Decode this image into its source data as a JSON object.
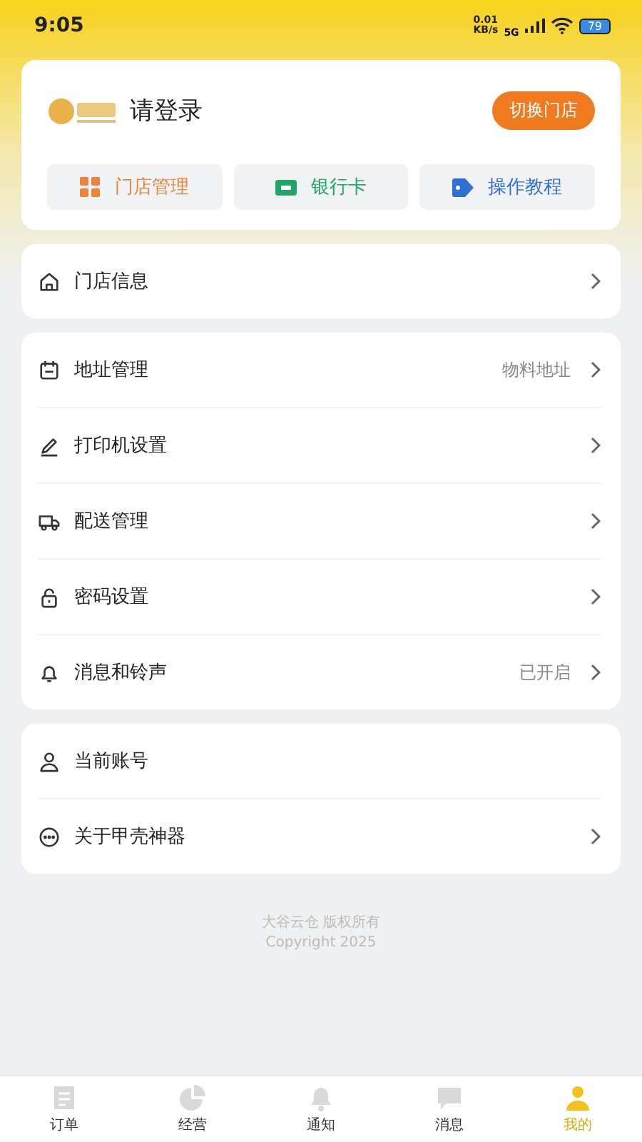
{
  "status_bar": {
    "time": "9:05",
    "speed": "0.01",
    "speed_unit": "KB/s",
    "network": "5G",
    "battery": "79"
  },
  "header": {
    "store_name": "请登录",
    "switch_button": "切换门店",
    "shortcuts": [
      {
        "kind": "grid",
        "label": "门店管理",
        "color": "#e8853a"
      },
      {
        "kind": "card",
        "label": "银行卡",
        "color": "#22a567"
      },
      {
        "kind": "tag",
        "label": "操作教程",
        "color": "#2f6fd8"
      }
    ]
  },
  "groups": [
    [
      {
        "kind": "home",
        "label": "门店信息"
      }
    ],
    [
      {
        "kind": "calendar",
        "label": "地址管理",
        "value": "物料地址"
      },
      {
        "kind": "pen",
        "label": "打印机设置"
      },
      {
        "kind": "truck",
        "label": "配送管理"
      },
      {
        "kind": "lock",
        "label": "密码设置"
      },
      {
        "kind": "bell",
        "label": "消息和铃声",
        "value": "已开启"
      }
    ],
    [
      {
        "kind": "person",
        "label": "当前账号",
        "arrow": false
      },
      {
        "kind": "dots",
        "label": "关于甲壳神器",
        "arrow": true
      }
    ]
  ],
  "footer": {
    "owner": "大谷云仓 版权所有",
    "copyright": "Copyright 2025"
  },
  "tabs": [
    {
      "kind": "doc",
      "label": "订单",
      "selected": false
    },
    {
      "kind": "pie",
      "label": "经营",
      "selected": false
    },
    {
      "kind": "bell",
      "label": "通知",
      "selected": false
    },
    {
      "kind": "chat",
      "label": "消息",
      "selected": false
    },
    {
      "kind": "person",
      "label": "我的",
      "selected": true
    }
  ]
}
